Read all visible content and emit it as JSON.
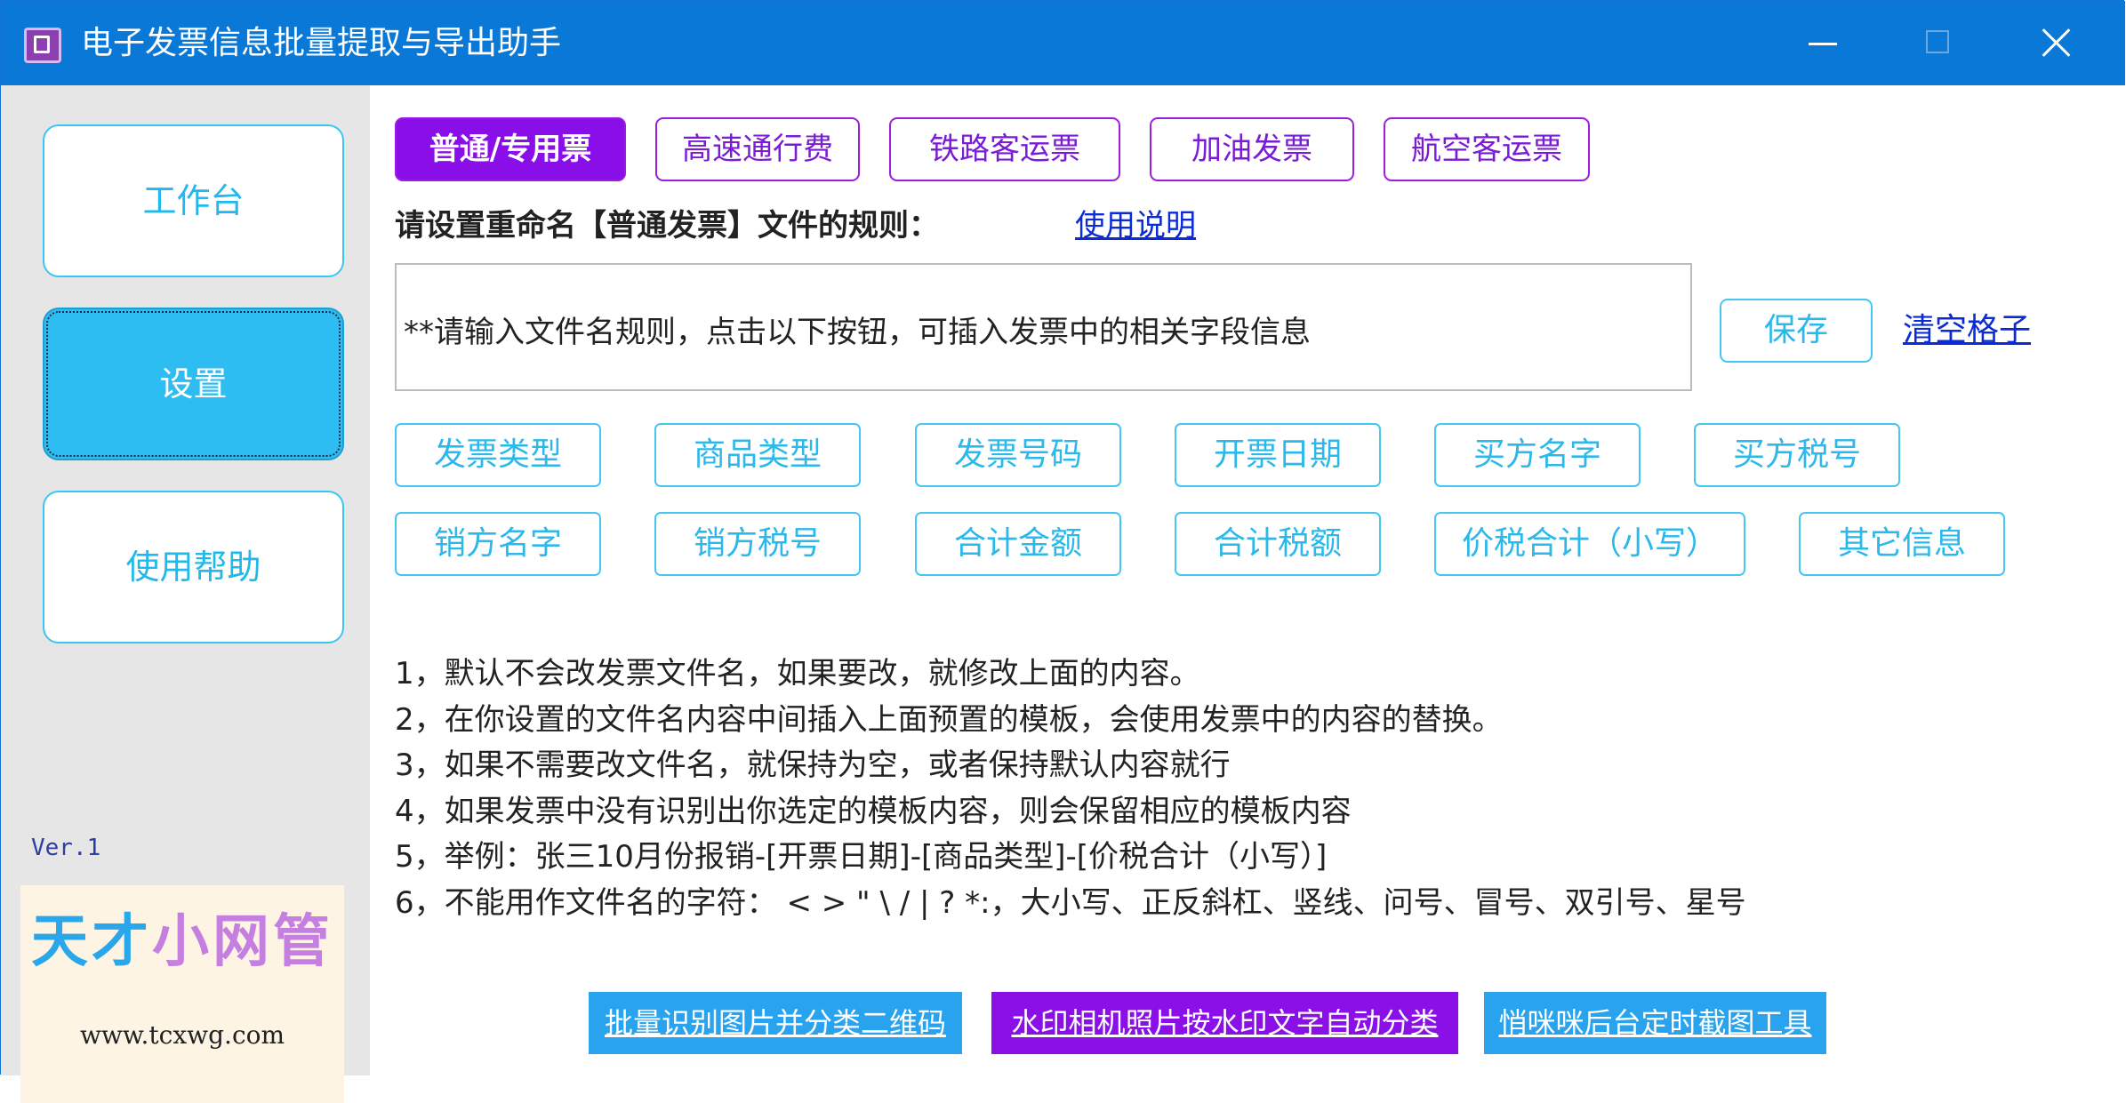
{
  "window": {
    "title": "电子发票信息批量提取与导出助手",
    "colors": {
      "titlebar": "#0a78d7",
      "accent_purple": "#8a0ee8",
      "accent_cyan": "#2ebdf2"
    }
  },
  "sidebar": {
    "items": [
      {
        "label": "工作台",
        "active": false
      },
      {
        "label": "设置",
        "active": true
      },
      {
        "label": "使用帮助",
        "active": false
      }
    ],
    "version": "Ver.1",
    "brand": {
      "name_part1": "天才",
      "name_part2": "小网管",
      "url": "www.tcxwg.com"
    }
  },
  "tabs": [
    {
      "label": "普通/专用票",
      "active": true
    },
    {
      "label": "高速通行费",
      "active": false
    },
    {
      "label": "铁路客运票",
      "active": false
    },
    {
      "label": "加油发票",
      "active": false
    },
    {
      "label": "航空客运票",
      "active": false
    }
  ],
  "rule": {
    "label": "请设置重命名【普通发票】文件的规则：",
    "help_link": "使用说明",
    "input_value": "**请输入文件名规则，点击以下按钮，可插入发票中的相关字段信息",
    "save_label": "保存",
    "clear_label": "清空格子"
  },
  "fields": [
    [
      "发票类型",
      "商品类型",
      "发票号码",
      "开票日期",
      "买方名字",
      "买方税号"
    ],
    [
      "销方名字",
      "销方税号",
      "合计金额",
      "合计税额",
      "价税合计（小写）",
      "其它信息"
    ]
  ],
  "notes": [
    "1，默认不会改发票文件名，如果要改，就修改上面的内容。",
    "2，在你设置的文件名内容中间插入上面预置的模板，会使用发票中的内容的替换。",
    "3，如果不需要改文件名，就保持为空，或者保持默认内容就行",
    "4，如果发票中没有识别出你选定的模板内容，则会保留相应的模板内容",
    "5，举例：张三10月份报销-[开票日期]-[商品类型]-[价税合计（小写）]",
    "6，不能用作文件名的字符： < > \" \\ / | ? *:，大小写、正反斜杠、竖线、问号、冒号、双引号、星号"
  ],
  "promos": [
    {
      "label": "批量识别图片并分类二维码",
      "color": "#2aa3ee"
    },
    {
      "label": "水印相机照片按水印文字自动分类",
      "color": "#8b10e8"
    },
    {
      "label": "悄咪咪后台定时截图工具",
      "color": "#2aa3ee"
    }
  ]
}
